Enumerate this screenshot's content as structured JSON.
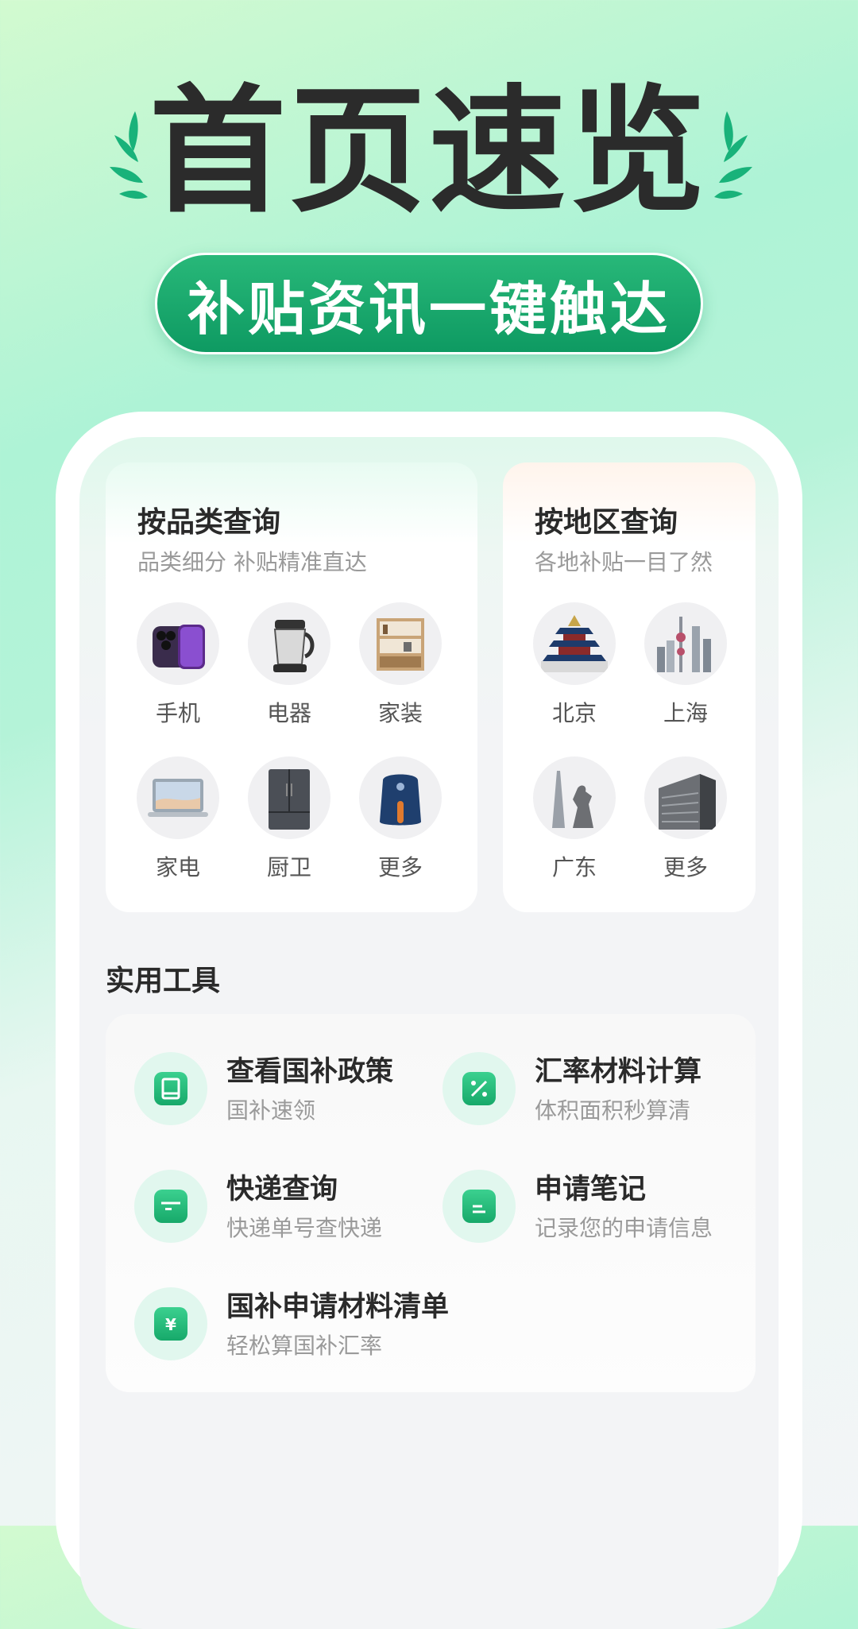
{
  "hero": {
    "title": "首页速览",
    "banner": "补贴资讯一键触达"
  },
  "category_card": {
    "title": "按品类查询",
    "subtitle": "品类细分 补贴精准直达",
    "items": [
      {
        "label": "手机",
        "icon": "phone-icon"
      },
      {
        "label": "电器",
        "icon": "blender-icon"
      },
      {
        "label": "家装",
        "icon": "shelf-icon"
      },
      {
        "label": "家电",
        "icon": "laptop-icon"
      },
      {
        "label": "厨卫",
        "icon": "fridge-icon"
      },
      {
        "label": "更多",
        "icon": "fryer-icon"
      }
    ]
  },
  "region_card": {
    "title": "按地区查询",
    "subtitle": "各地补贴一目了然",
    "items": [
      {
        "label": "北京",
        "icon": "temple-icon"
      },
      {
        "label": "上海",
        "icon": "skyline-icon"
      },
      {
        "label": "广东",
        "icon": "tower-icon"
      },
      {
        "label": "更多",
        "icon": "building-icon"
      }
    ]
  },
  "tools": {
    "section_title": "实用工具",
    "items": [
      {
        "title": "查看国补政策",
        "subtitle": "国补速领",
        "icon": "book-icon"
      },
      {
        "title": "汇率材料计算",
        "subtitle": "体积面积秒算清",
        "icon": "percent-icon"
      },
      {
        "title": "快递查询",
        "subtitle": "快递单号查快递",
        "icon": "package-icon"
      },
      {
        "title": "申请笔记",
        "subtitle": "记录您的申请信息",
        "icon": "document-icon"
      },
      {
        "title": "国补申请材料清单",
        "subtitle": "轻松算国补汇率",
        "icon": "yuan-icon"
      }
    ]
  },
  "colors": {
    "accent": "#17a96a",
    "banner_green": "#0e9a62",
    "icon_bg": "#e1f7ee"
  }
}
